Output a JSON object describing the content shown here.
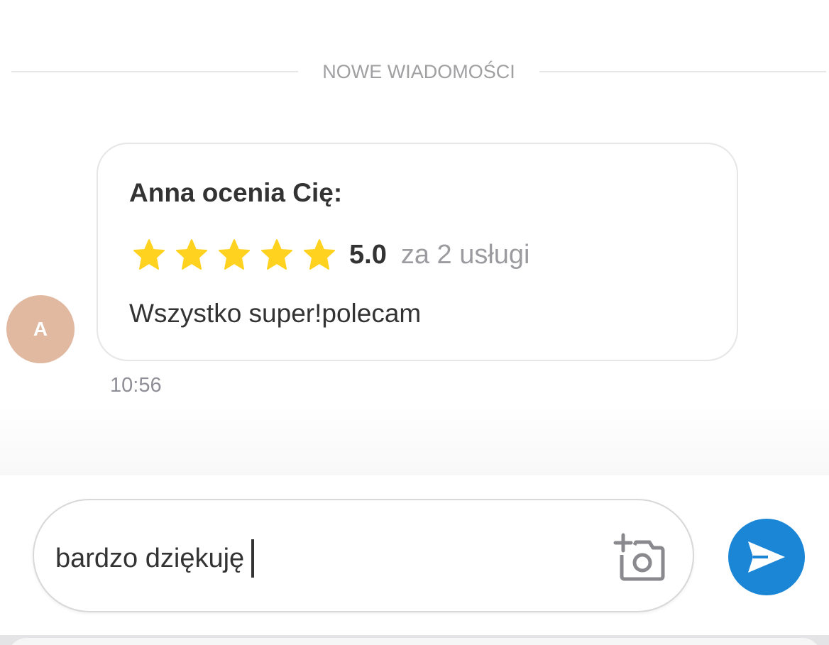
{
  "divider": {
    "label": "NOWE WIADOMOŚCI"
  },
  "message": {
    "avatar_initial": "A",
    "title": "Anna ocenia Cię:",
    "rating": {
      "stars": 5,
      "max_stars": 5,
      "value_text": "5.0",
      "note": "za 2 usługi"
    },
    "text": "Wszystko super!polecam",
    "time": "10:56"
  },
  "composer": {
    "input_value": "bardzo dziękuję",
    "camera_icon": "add-photo-camera-icon",
    "send_icon": "send-arrow-icon"
  },
  "colors": {
    "star": "#ffd21f",
    "avatar_bg": "#e0b9a0",
    "send_button": "#1b86d6",
    "muted_text": "#a0a0a3"
  }
}
